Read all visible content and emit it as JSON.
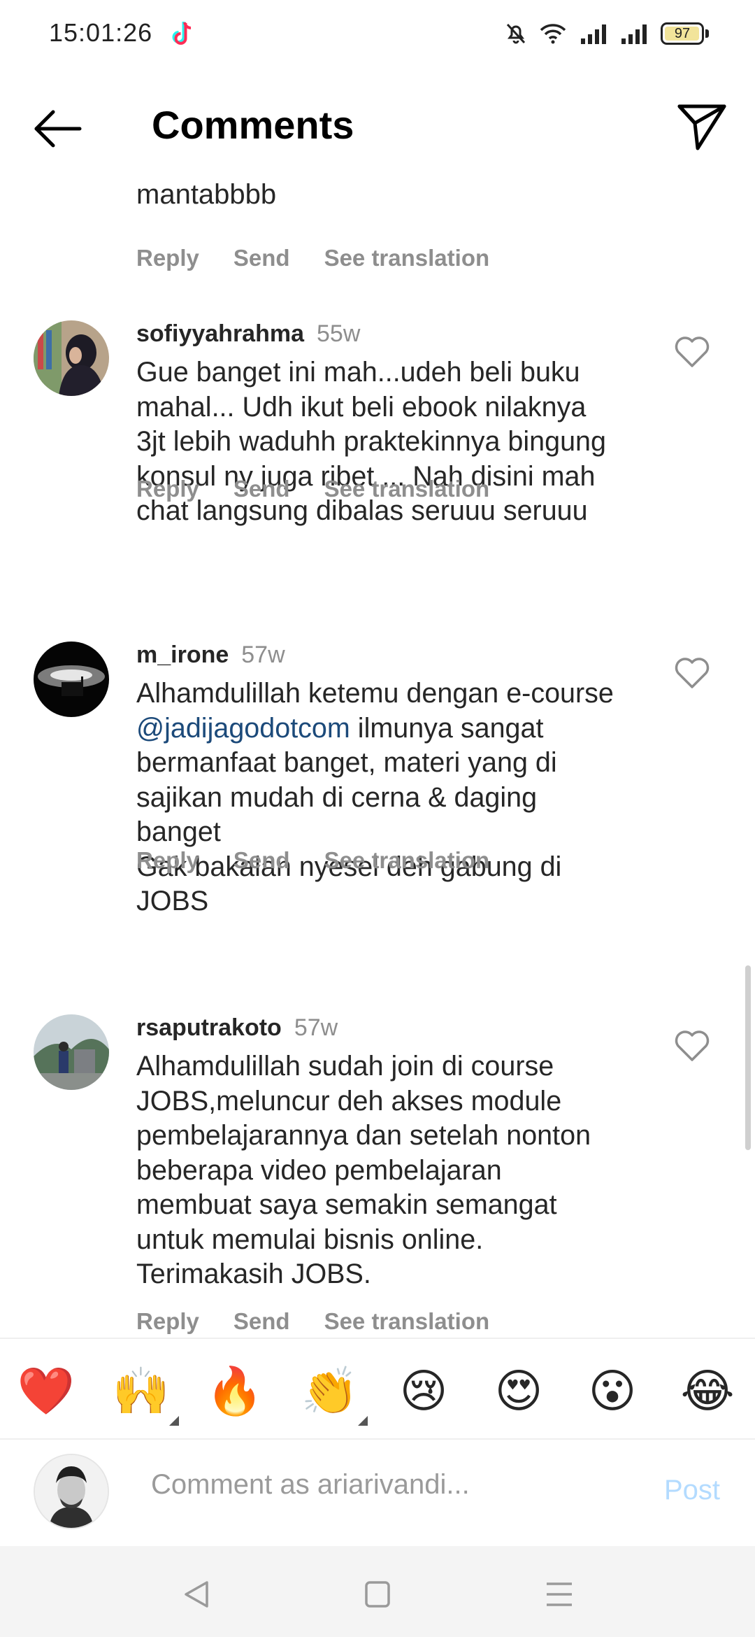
{
  "status": {
    "time": "15:01:26",
    "battery": "97",
    "battery_level": 0.97
  },
  "header": {
    "title": "Comments",
    "back_icon": "arrow-left-icon",
    "share_icon": "paper-plane-icon"
  },
  "partial_comment": {
    "text": "mantabbbb",
    "actions": [
      "Reply",
      "Send",
      "See translation"
    ]
  },
  "comments": [
    {
      "username": "sofiyyahrahma",
      "time": "55w",
      "lines": [
        "Gue banget ini mah...udeh beli buku",
        "mahal... Udh ikut beli ebook nilaknya",
        "3jt lebih waduhh praktekinnya bingung",
        "konsul ny juga ribet ... Nah disini mah",
        "chat langsung dibalas seruuu seruuu"
      ],
      "actions": [
        "Reply",
        "Send",
        "See translation"
      ]
    },
    {
      "username": "m_irone",
      "time": "57w",
      "line1": "Alhamdulillah ketemu dengan e-course",
      "mention": "@jadijagodotcom",
      "line2_rest": " ilmunya sangat",
      "lines": [
        "bermanfaat banget, materi yang di",
        "sajikan mudah di cerna & daging",
        "banget",
        "Gak bakalan nyesel deh gabung di",
        "JOBS"
      ],
      "actions": [
        "Reply",
        "Send",
        "See translation"
      ]
    },
    {
      "username": "rsaputrakoto",
      "time": "57w",
      "lines": [
        "Alhamdulillah sudah join di course",
        "JOBS,meluncur deh akses module",
        "pembelajarannya dan setelah nonton",
        "beberapa video pembelajaran",
        "membuat saya semakin semangat",
        "untuk memulai bisnis online.",
        "Terimakasih JOBS."
      ],
      "actions": [
        "Reply",
        "Send",
        "See translation"
      ]
    }
  ],
  "emoji_bar": [
    "❤️",
    "🙌",
    "🔥",
    "👏",
    "😢",
    "😍",
    "😮",
    "😂"
  ],
  "composer": {
    "placeholder": "Comment as ariarivandi...",
    "post_label": "Post"
  },
  "nav": [
    "back-triangle-icon",
    "home-square-icon",
    "menu-lines-icon"
  ]
}
